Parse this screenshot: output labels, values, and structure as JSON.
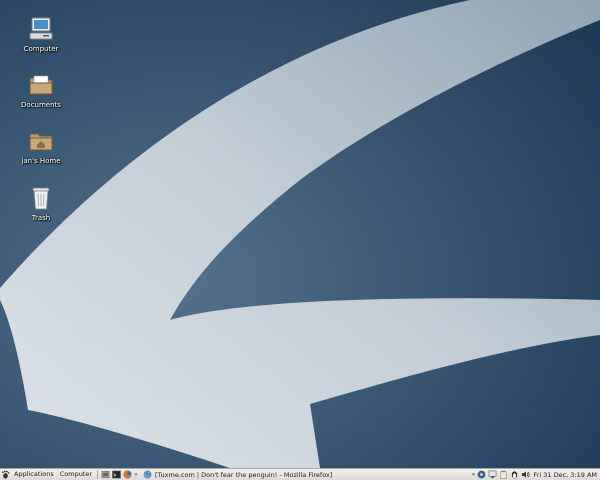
{
  "desktop": {
    "icons": [
      {
        "label": "Computer",
        "icon": "computer-icon"
      },
      {
        "label": "Documents",
        "icon": "folder-icon"
      },
      {
        "label": "jan's Home",
        "icon": "home-folder-icon"
      },
      {
        "label": "Trash",
        "icon": "trash-icon"
      }
    ]
  },
  "panel": {
    "applications_label": "Applications",
    "computer_label": "Computer",
    "window_title": "[Tuxme.com | Don't fear the penguin! - Mozilla Firefox]",
    "clock": "Fri 31 Dec,  3:19 AM"
  },
  "colors": {
    "wallpaper_dark": "#1f3d5c",
    "wallpaper_light": "#c9d2da",
    "panel": "#e6e4e0"
  }
}
